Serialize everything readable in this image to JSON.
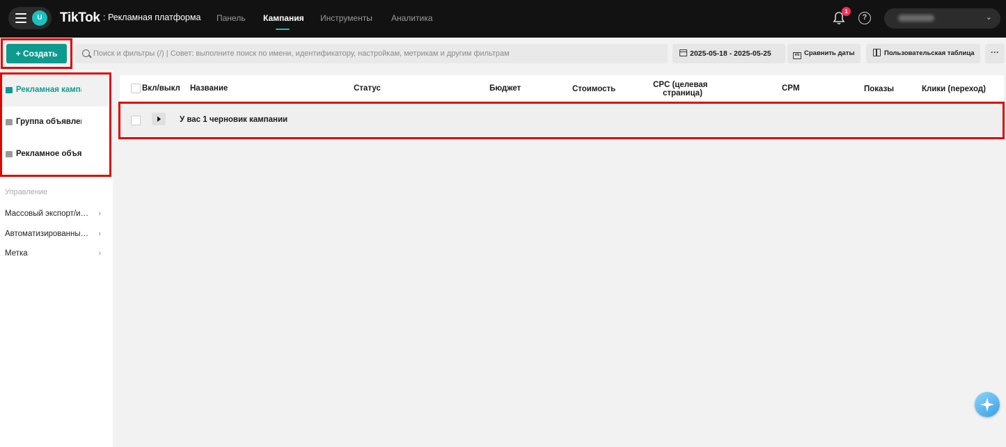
{
  "topbar": {
    "avatar_initial": "U",
    "logo": "TikTok",
    "logo_suffix": ": Рекламная платформа",
    "nav": [
      {
        "label": "Панель",
        "active": false
      },
      {
        "label": "Кампания",
        "active": true
      },
      {
        "label": "Инструменты",
        "active": false
      },
      {
        "label": "Аналитика",
        "active": false
      }
    ],
    "notification_count": "1",
    "help_glyph": "?"
  },
  "toolbar": {
    "create_label": "+ Создать",
    "search_placeholder": "Поиск и фильтры (/) | Совет: выполните поиск по имени, идентификатору, настройкам, метрикам и другим фильтрам",
    "date_range": "2025-05-18 - 2025-05-25",
    "compare_label": "Сравнить даты",
    "custom_table_label": "Пользовательская таблица",
    "more_label": "···"
  },
  "sidebar": {
    "levels": [
      {
        "label": "Рекламная кампания",
        "active": true
      },
      {
        "label": "Группа объявлений",
        "active": false
      },
      {
        "label": "Рекламное объявление",
        "active": false
      }
    ],
    "section_title": "Управление",
    "links": [
      {
        "label": "Массовый экспорт/импорт"
      },
      {
        "label": "Автоматизированные правила"
      },
      {
        "label": "Метка"
      }
    ]
  },
  "table": {
    "columns": [
      {
        "label": "Вкл/выкл"
      },
      {
        "label": "Название"
      },
      {
        "label": "Статус"
      },
      {
        "label": "Бюджет"
      },
      {
        "label": "Стоимость"
      },
      {
        "label": "CPC (целевая"
      },
      {
        "label": "страница)"
      },
      {
        "label": "CPM"
      },
      {
        "label": "Показы"
      },
      {
        "label": "Клики (переход)"
      }
    ],
    "draft_row_text": "У вас 1 черновик кампании"
  },
  "colors": {
    "accent": "#0f9a8f",
    "highlight": "#e10600",
    "topbar": "#121212"
  }
}
